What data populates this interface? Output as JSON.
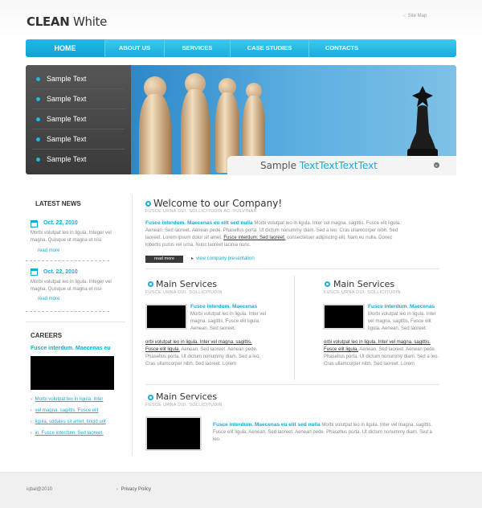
{
  "brand": {
    "strong": "CLEAN",
    "light": "White"
  },
  "header": {
    "sitemap": "Site Map"
  },
  "nav": [
    {
      "label": "HOME"
    },
    {
      "label": "ABOUT US"
    },
    {
      "label": "SERVICES"
    },
    {
      "label": "CASE STUDIES"
    },
    {
      "label": "CONTACTS"
    }
  ],
  "sidebar_menu": [
    "Sample Text",
    "Sample Text",
    "Sample Text",
    "Sample Text",
    "Sample Text"
  ],
  "banner": {
    "caption_plain": "Sample ",
    "caption_blue": "TextTextTextText"
  },
  "latest_news": {
    "heading": "LATEST NEWS",
    "items": [
      {
        "date": "Oct. 22, 2010",
        "text": "Morbi volutpat leo in ligula. Integer vel magna. Quisque ut magna et nisi",
        "more": "read more"
      },
      {
        "date": "Oct. 22, 2010",
        "text": "Morbi volutpat leo in ligula. Integer vel magna. Quisque ut magna et nisi",
        "more": "read more"
      }
    ]
  },
  "careers": {
    "heading": "CAREERS",
    "title": "Fusce interdum. Maecenas eu",
    "links": [
      "Morbi volutpat leo in ligula. Inter",
      "vel magna. sagittis. Fusce elit",
      "ligula, sodales sit amet, tincid unt",
      "in. Fusce interdum. Sed laoreet."
    ]
  },
  "welcome": {
    "title": "Welcome to our Company!",
    "subtitle": "FUSCE URNA DUI. SOLLICITUDIN AC. PULVINAR",
    "lead": "Fusce interdum. Maecenas eu elit sed nulla",
    "text1": " Morbi volutpat leo in ligula. Inter vel magna. sagittis. Fusce elit ligula.  Aenean. Sed laoreet. Aenean pede. Phasellus porta. Ut dictum nonummy diam. Sed a leo. Cras ullamcorper nibh. Sed laoreet. Lorem ipsum dolor sit amet. ",
    "underlined": "Fusce interdum. Sed laoreet.",
    "text2": " consectetuer adipiscing elit. Nam eu nulla. Donec lobortis purus vel urna. Nunc laoreet lacinia nunc.",
    "read_more": "read more",
    "view": "view company presentation"
  },
  "services": [
    {
      "title": "Main Services",
      "subtitle": "FUSCE URNA DUI. SOLLICITUDIN",
      "lead": "Fusce interdum. Maecenas",
      "short": "Morbi volutpat leo in ligula. Inter vel magna. sagittis. Fusce elit ligula.  Aenean. Sed laoreet.",
      "u1": "orbi volutpat leo in ligula. Inter vel magna. sagittis.",
      "u2": "Fusce elit ligula.",
      "rest": "  Aenean. Sed laoreet. Aenean pede. Phasellus porta. Ut dictum nonummy diam. Sed a leo. Cras ullamcorper nibh. Sed laoreet. Lorem"
    },
    {
      "title": "Main Services",
      "subtitle": "FUSCE URNA DUI. SOLLICITUDIN",
      "lead": "Fusce interdum. Maecenas",
      "short": "Morbi volutpat leo in ligula. Inter vel magna. sagittis. Fusce elit ligula.  Aenean. Sed laoreet.",
      "u1": "orbi volutpat leo in ligula. Inter vel magna. sagittis.",
      "u2": "Fusce elit ligula.",
      "rest": "  Aenean. Sed laoreet. Aenean pede. Phasellus porta. Ut dictum nonummy diam. Sed a leo. Cras ullamcorper nibh. Sed laoreet. Lorem"
    },
    {
      "title": "Main Services",
      "subtitle": "FUSCE URNA DUI. SOLLICITUDIN",
      "lead": "Fusce interdum. Maecenas eu elit sed nulla",
      "text": " Morbi volutpat leo in ligula. Inter vel magna. sagittis. Fusce elit ligula.  Aenean. Sed laoreet. Aenean pede. Phasellus porta. Ut dictum nonummy diam. Sed a leo."
    }
  ],
  "footer": {
    "copyright": "iqbal@2010",
    "privacy": "Privacy  Policy"
  },
  "colors": {
    "accent": "#16abd6",
    "nav": "#1cb4e4",
    "dark": "#3a3a3a"
  },
  "icons": {
    "bullet": "circle-bullet-icon",
    "calendar": "calendar-icon",
    "arrow": "arrow-right-icon"
  }
}
